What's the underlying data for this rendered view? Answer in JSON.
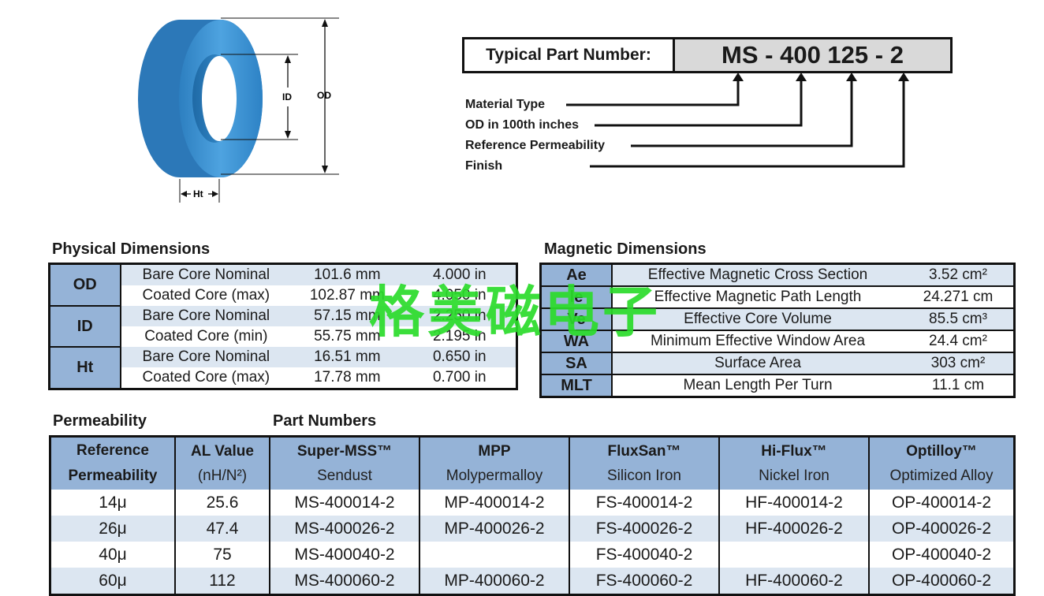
{
  "diagram": {
    "od_label": "OD",
    "id_label": "ID",
    "ht_label": "Ht"
  },
  "part_number": {
    "label": "Typical Part Number:",
    "value": "MS - 400 125 - 2",
    "legend": [
      "Material Type",
      "OD in 100th inches",
      "Reference Permeability",
      "Finish"
    ]
  },
  "physical": {
    "title": "Physical Dimensions",
    "rows": [
      {
        "header": "OD",
        "lines": [
          {
            "desc": "Bare Core Nominal",
            "mm": "101.6 mm",
            "in": "4.000 in"
          },
          {
            "desc": "Coated Core (max)",
            "mm": "102.87 mm",
            "in": "4.050 in"
          }
        ]
      },
      {
        "header": "ID",
        "lines": [
          {
            "desc": "Bare Core Nominal",
            "mm": "57.15 mm",
            "in": "2.250 in"
          },
          {
            "desc": "Coated Core (min)",
            "mm": "55.75 mm",
            "in": "2.195 in"
          }
        ]
      },
      {
        "header": "Ht",
        "lines": [
          {
            "desc": "Bare Core Nominal",
            "mm": "16.51 mm",
            "in": "0.650 in"
          },
          {
            "desc": "Coated Core (max)",
            "mm": "17.78 mm",
            "in": "0.700 in"
          }
        ]
      }
    ]
  },
  "magnetic": {
    "title": "Magnetic Dimensions",
    "rows": [
      {
        "sym": "Ae",
        "desc": "Effective  Magnetic Cross Section",
        "val": "3.52 cm²"
      },
      {
        "sym": "le",
        "desc": "Effective  Magnetic Path Length",
        "val": "24.271 cm"
      },
      {
        "sym": "Ve",
        "desc": "Effective Core Volume",
        "val": "85.5 cm³"
      },
      {
        "sym": "WA",
        "desc": "Minimum Effective Window Area",
        "val": "24.4 cm²"
      },
      {
        "sym": "SA",
        "desc": "Surface Area",
        "val": "303 cm²"
      },
      {
        "sym": "MLT",
        "desc": "Mean Length Per Turn",
        "val": "11.1 cm"
      }
    ]
  },
  "permeability": {
    "title": "Permeability",
    "part_numbers_title": "Part Numbers",
    "columns": [
      {
        "title": "Reference",
        "sub": "Permeability"
      },
      {
        "title": "AL Value",
        "sub": "(nH/N²)"
      },
      {
        "title": "Super-MSS™",
        "sub": "Sendust"
      },
      {
        "title": "MPP",
        "sub": "Molypermalloy"
      },
      {
        "title": "FluxSan™",
        "sub": "Silicon Iron"
      },
      {
        "title": "Hi-Flux™",
        "sub": "Nickel Iron"
      },
      {
        "title": "Optilloy™",
        "sub": "Optimized Alloy"
      }
    ],
    "rows": [
      [
        "14μ",
        "25.6",
        "MS-400014-2",
        "MP-400014-2",
        "FS-400014-2",
        "HF-400014-2",
        "OP-400014-2"
      ],
      [
        "26μ",
        "47.4",
        "MS-400026-2",
        "MP-400026-2",
        "FS-400026-2",
        "HF-400026-2",
        "OP-400026-2"
      ],
      [
        "40μ",
        "75",
        "MS-400040-2",
        "",
        "FS-400040-2",
        "",
        "OP-400040-2"
      ],
      [
        "60μ",
        "112",
        "MS-400060-2",
        "MP-400060-2",
        "FS-400060-2",
        "HF-400060-2",
        "OP-400060-2"
      ]
    ]
  },
  "watermark": "格美磁电子",
  "colors": {
    "header_blue": "#95b3d7",
    "row_light": "#dce6f1",
    "core_blue": "#3a8fd0",
    "watermark_green": "#2bdc2b"
  }
}
